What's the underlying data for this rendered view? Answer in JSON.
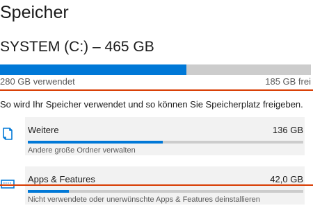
{
  "page": {
    "title": "Speicher"
  },
  "drive": {
    "title": "SYSTEM (C:) – 465 GB",
    "used_label": "280 GB verwendet",
    "free_label": "185 GB frei",
    "used_fraction": 0.6
  },
  "info": {
    "text": "So wird Ihr Speicher verwendet und so können Sie Speicherplatz freigeben."
  },
  "categories": [
    {
      "name": "Weitere",
      "size": "136 GB",
      "description": "Andere große Ordner verwalten",
      "used_fraction": 0.49,
      "icon": "folder-icon"
    },
    {
      "name": "Apps & Features",
      "size": "42,0 GB",
      "description": "Nicht verwendete oder unerwünschte Apps & Features deinstallieren",
      "used_fraction": 0.15,
      "icon": "apps-icon"
    }
  ],
  "colors": {
    "accent": "#0078d7",
    "bar_track": "#cccccc",
    "annotation_line": "#d83b01",
    "category_bg": "#f2f2f2"
  }
}
